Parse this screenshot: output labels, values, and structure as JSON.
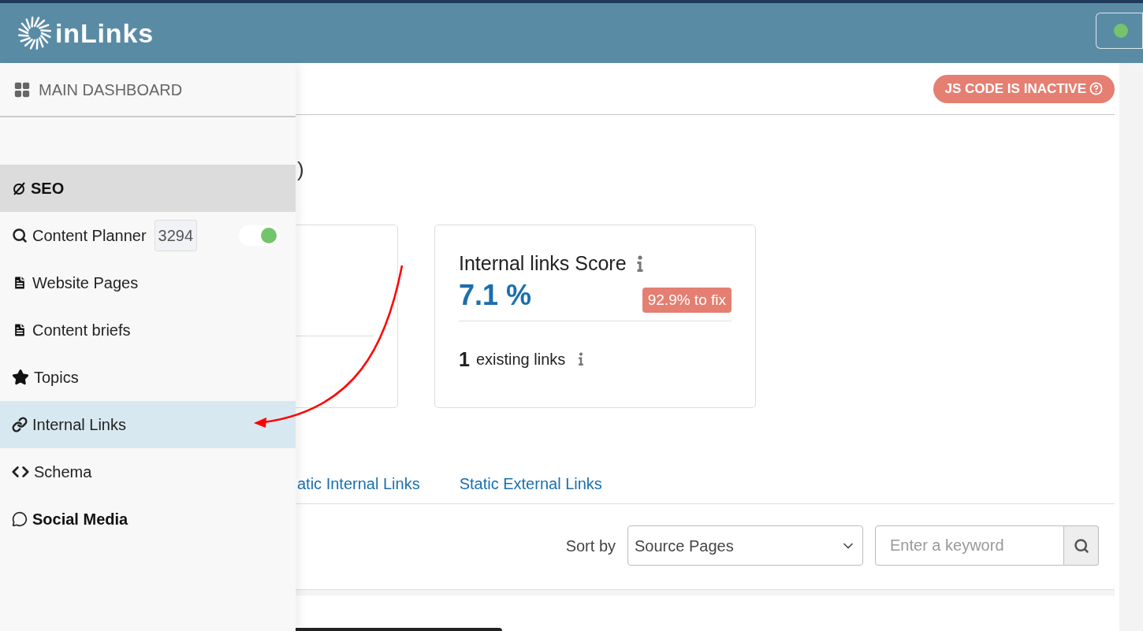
{
  "header": {
    "logo_text": "inLinks",
    "status_on": true
  },
  "sidebar": {
    "dashboard_label": "MAIN DASHBOARD",
    "items": [
      {
        "kind": "section",
        "label": "SEO"
      },
      {
        "kind": "item",
        "label": "Content Planner",
        "badge": "3294",
        "toggle_on": true,
        "selected": false,
        "emphasized": false
      },
      {
        "kind": "item",
        "label": "Website Pages",
        "selected": false,
        "emphasized": false
      },
      {
        "kind": "item",
        "label": "Content briefs",
        "selected": false,
        "emphasized": false
      },
      {
        "kind": "item",
        "label": "Topics",
        "selected": false,
        "emphasized": false
      },
      {
        "kind": "item",
        "label": "Internal Links",
        "selected": true,
        "emphasized": false
      },
      {
        "kind": "item",
        "label": "Schema",
        "selected": false,
        "emphasized": false
      },
      {
        "kind": "item",
        "label": "Social Media",
        "selected": false,
        "emphasized": true
      }
    ]
  },
  "main": {
    "js_badge": "JS CODE IS INACTIVE",
    "heading_fragment": ")",
    "score_card": {
      "title": "Internal links Score",
      "value": "7.1 %",
      "fix_badge": "92.9% to fix",
      "count": "1",
      "count_label": "existing links"
    },
    "tabs": [
      {
        "label": "atic Internal Links",
        "selected": false
      },
      {
        "label": "Static External Links",
        "selected": false
      }
    ],
    "sort_label": "Sort by",
    "sort_value": "Source Pages",
    "search_placeholder": "Enter a keyword"
  }
}
